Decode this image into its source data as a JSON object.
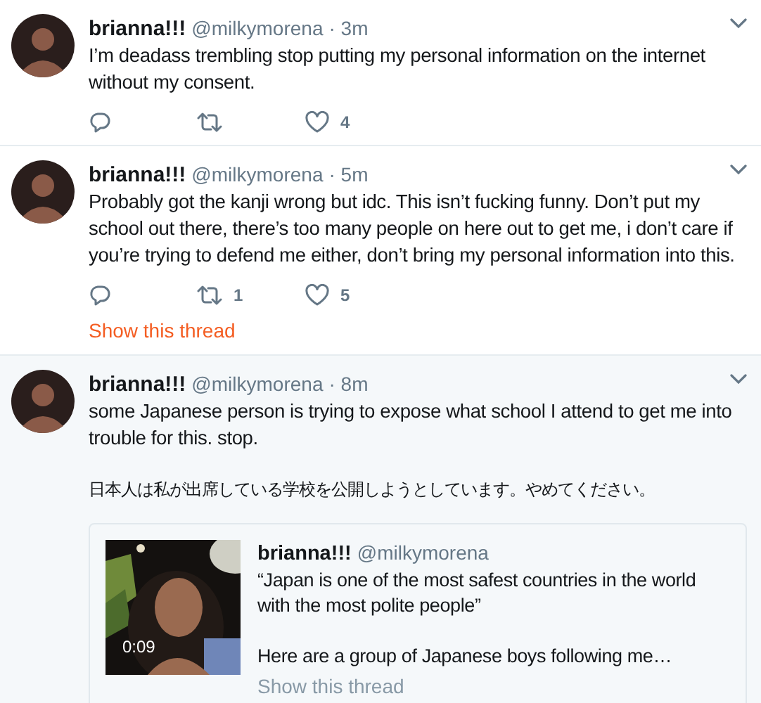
{
  "tweets": [
    {
      "name": "brianna!!!",
      "handle": "@milkymorena",
      "time": "· 3m",
      "highlighted": false,
      "paragraphs": [
        "I’m deadass trembling stop putting my personal information on the internet without my consent."
      ],
      "actions": [
        {
          "kind": "reply"
        },
        {
          "kind": "retweet"
        },
        {
          "kind": "like",
          "count": "4"
        }
      ]
    },
    {
      "name": "brianna!!!",
      "handle": "@milkymorena",
      "time": "· 5m",
      "highlighted": false,
      "paragraphs": [
        "Probably got the kanji wrong but idc. This isn’t fucking funny. Don’t put my school out there, there’s too many people on here out to get me, i don’t care if you’re trying to defend me either, don’t bring my personal information into this."
      ],
      "actions": [
        {
          "kind": "reply"
        },
        {
          "kind": "retweet",
          "count": "1"
        },
        {
          "kind": "like",
          "count": "5"
        }
      ],
      "show_thread": "Show this thread"
    },
    {
      "name": "brianna!!!",
      "handle": "@milkymorena",
      "time": "· 8m",
      "highlighted": true,
      "paragraphs": [
        "some Japanese person is trying to expose what school I attend to get me into trouble for this. stop.",
        "日本人は私が出席している学校を公開しようとしています。やめてください。"
      ],
      "quote": {
        "name": "brianna!!!",
        "handle": "@milkymorena",
        "duration": "0:09",
        "paragraphs": [
          "“Japan is one of the most safest countries in the world with the most polite people”",
          "Here are a group of Japanese boys following me…"
        ],
        "show_thread": "Show this thread"
      }
    }
  ]
}
